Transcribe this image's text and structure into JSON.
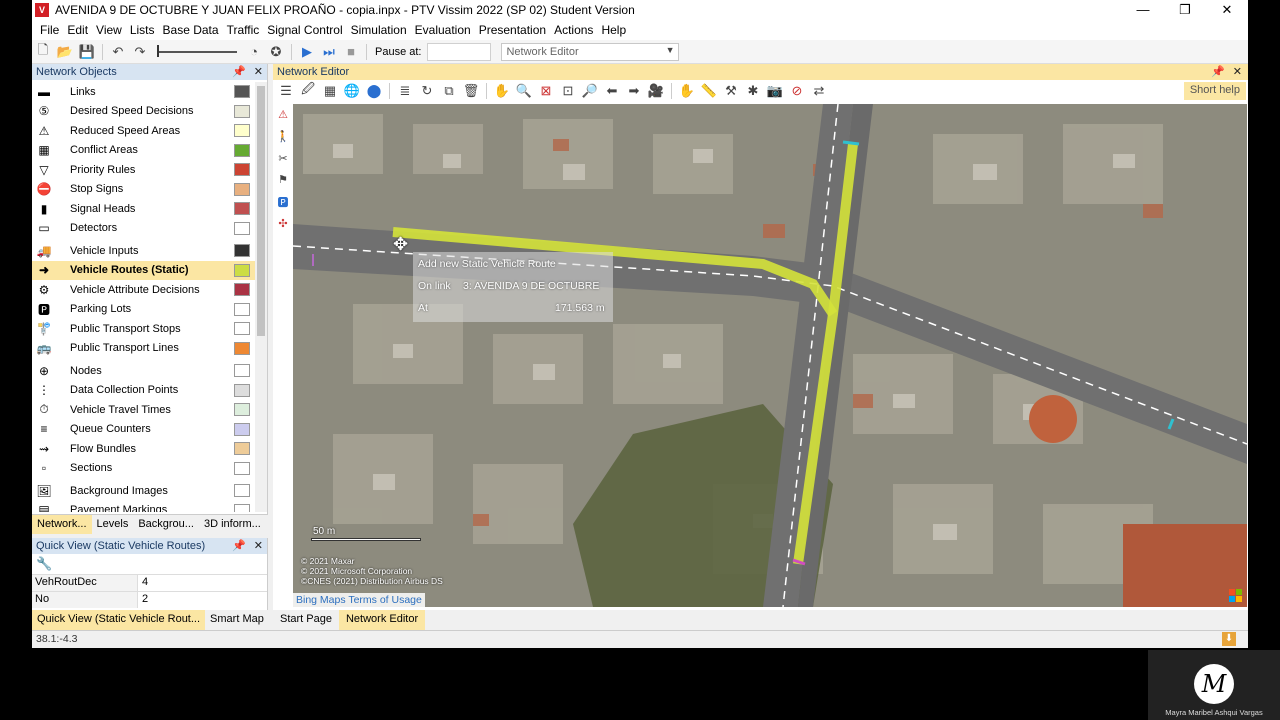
{
  "window": {
    "title": "AVENIDA 9 DE OCTUBRE Y JUAN FELIX PROAÑO - copia.inpx - PTV Vissim 2022 (SP 02) Student Version",
    "minimize": "—",
    "maximize": "❐",
    "close": "✕"
  },
  "menu": [
    "File",
    "Edit",
    "View",
    "Lists",
    "Base Data",
    "Traffic",
    "Signal Control",
    "Simulation",
    "Evaluation",
    "Presentation",
    "Actions",
    "Help"
  ],
  "toolbar": {
    "pause_label": "Pause at:",
    "pause_value": "",
    "editor_select": "Network Editor"
  },
  "network_objects": {
    "title": "Network Objects",
    "items": [
      {
        "label": "Links",
        "swatch": "#555555"
      },
      {
        "label": "Desired Speed Decisions",
        "swatch": "#e8e8d8"
      },
      {
        "label": "Reduced Speed Areas",
        "swatch": "#ffffcc"
      },
      {
        "label": "Conflict Areas",
        "swatch": "#66aa33"
      },
      {
        "label": "Priority Rules",
        "swatch": "#cc4433"
      },
      {
        "label": "Stop Signs",
        "swatch": "#e8b080"
      },
      {
        "label": "Signal Heads",
        "swatch": "#c05050"
      },
      {
        "label": "Detectors",
        "swatch": "#ffffff"
      },
      {
        "label": "Vehicle Inputs",
        "swatch": "#333333"
      },
      {
        "label": "Vehicle Routes (Static)",
        "swatch": "#ccdd44"
      },
      {
        "label": "Vehicle Attribute Decisions",
        "swatch": "#aa3344"
      },
      {
        "label": "Parking Lots",
        "swatch": "#ffffff"
      },
      {
        "label": "Public Transport Stops",
        "swatch": "#ffffff"
      },
      {
        "label": "Public Transport Lines",
        "swatch": "#ee8833"
      },
      {
        "label": "Nodes",
        "swatch": "#ffffff"
      },
      {
        "label": "Data Collection Points",
        "swatch": "#dddddd"
      },
      {
        "label": "Vehicle Travel Times",
        "swatch": "#ddeedd"
      },
      {
        "label": "Queue Counters",
        "swatch": "#ccccee"
      },
      {
        "label": "Flow Bundles",
        "swatch": "#eecc99"
      },
      {
        "label": "Sections",
        "swatch": "#ffffff"
      },
      {
        "label": "Background Images",
        "swatch": "#ffffff"
      },
      {
        "label": "Pavement Markings",
        "swatch": "#ffffff"
      }
    ],
    "tabs": [
      "Network...",
      "Levels",
      "Backgrou...",
      "3D inform..."
    ]
  },
  "quick_view": {
    "title": "Quick View (Static Vehicle Routes)",
    "rows": [
      {
        "key": "VehRoutDec",
        "value": "4"
      },
      {
        "key": "No",
        "value": "2"
      }
    ],
    "tabs": [
      "Quick View (Static Vehicle Rout...",
      "Smart Map"
    ]
  },
  "network_editor": {
    "title": "Network Editor",
    "short_help": "Short help",
    "tooltip": {
      "line1": "Add new Static Vehicle Route",
      "line2_label": "On link",
      "line2_value": "3: AVENIDA 9 DE OCTUBRE",
      "line3_label": "At",
      "line3_value": "171.563 m"
    },
    "scale_label": "50 m",
    "attribution": [
      "© 2021 Maxar",
      "© 2021 Microsoft Corporation",
      "©CNES (2021) Distribution Airbus DS"
    ],
    "bing_terms": "Bing Maps Terms of Usage",
    "tabs": [
      "Start Page",
      "Network Editor"
    ]
  },
  "statusbar": {
    "coords": "38.1:-4.3"
  },
  "presenter": {
    "name": "Mayra Maribel Ashqui Vargas",
    "initial": "M"
  },
  "colors": {
    "selected_bg": "#fbe6a3",
    "panel_header": "#d7e4f2",
    "route_yellow": "#d4e23a"
  }
}
